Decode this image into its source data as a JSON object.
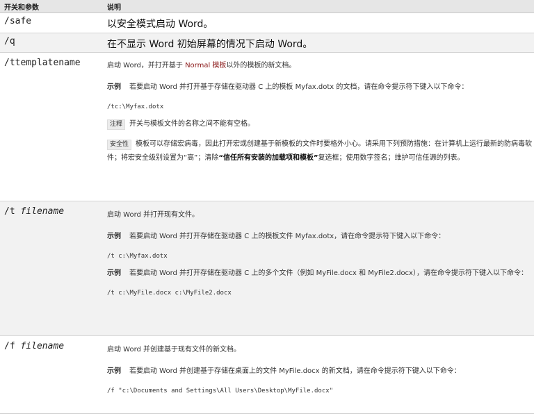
{
  "header": {
    "col1": "开关和参数",
    "col2": "说明"
  },
  "rows": {
    "safe": {
      "switch": "/safe",
      "desc": "以安全模式启动 Word。"
    },
    "q": {
      "switch": "/q",
      "desc": "在不显示 Word 初始屏幕的情况下启动 Word。"
    },
    "ttemplate": {
      "switch": "/ttemplatename",
      "desc_pre": "启动 Word，并打开基于 ",
      "desc_link": "Normal 模板",
      "desc_post": "以外的模板的新文档。",
      "example_label": "示例",
      "example_text": "若要启动 Word 并打开基于存储在驱动器 C 上的模板 Myfax.dotx 的文档，请在命令提示符下键入以下命令：",
      "code": "/tc:\\Myfax.dotx",
      "note_label": "注释",
      "note_text": "开关与模板文件的名称之间不能有空格。",
      "security_label": "安全性",
      "security_pre": "模板可以存储宏病毒，因此打开宏或创建基于新模板的文件时要格外小心。请采用下列预防措施：在计算机上运行最新的防病毒软件；将宏安全级别设置为“高”；清除",
      "security_bold": "“信任所有安装的加载项和模板”",
      "security_post": "复选框；使用数字签名；维护可信任源的列表。"
    },
    "tfile": {
      "switch": "/t",
      "param": "filename",
      "desc": "启动 Word 并打开现有文件。",
      "example1_label": "示例",
      "example1_text": "若要启动 Word 并打开存储在驱动器 C 上的模板文件 Myfax.dotx，请在命令提示符下键入以下命令：",
      "code1": "/t c:\\Myfax.dotx",
      "example2_label": "示例",
      "example2_text": "若要启动 Word 并打开存储在驱动器 C 上的多个文件（例如 MyFile.docx 和 MyFile2.docx），请在命令提示符下键入以下命令：",
      "code2": "/t c:\\MyFile.docx c:\\MyFile2.docx"
    },
    "ffile": {
      "switch": "/f",
      "param": "filename",
      "desc": "启动 Word 并创建基于现有文件的新文档。",
      "example_label": "示例",
      "example_text": "若要启动 Word 并创建基于存储在桌面上的文件 MyFile.docx 的新文档，请在命令提示符下键入以下命令：",
      "code": "/f \"c:\\Documents and Settings\\All Users\\Desktop\\MyFile.docx\""
    }
  }
}
